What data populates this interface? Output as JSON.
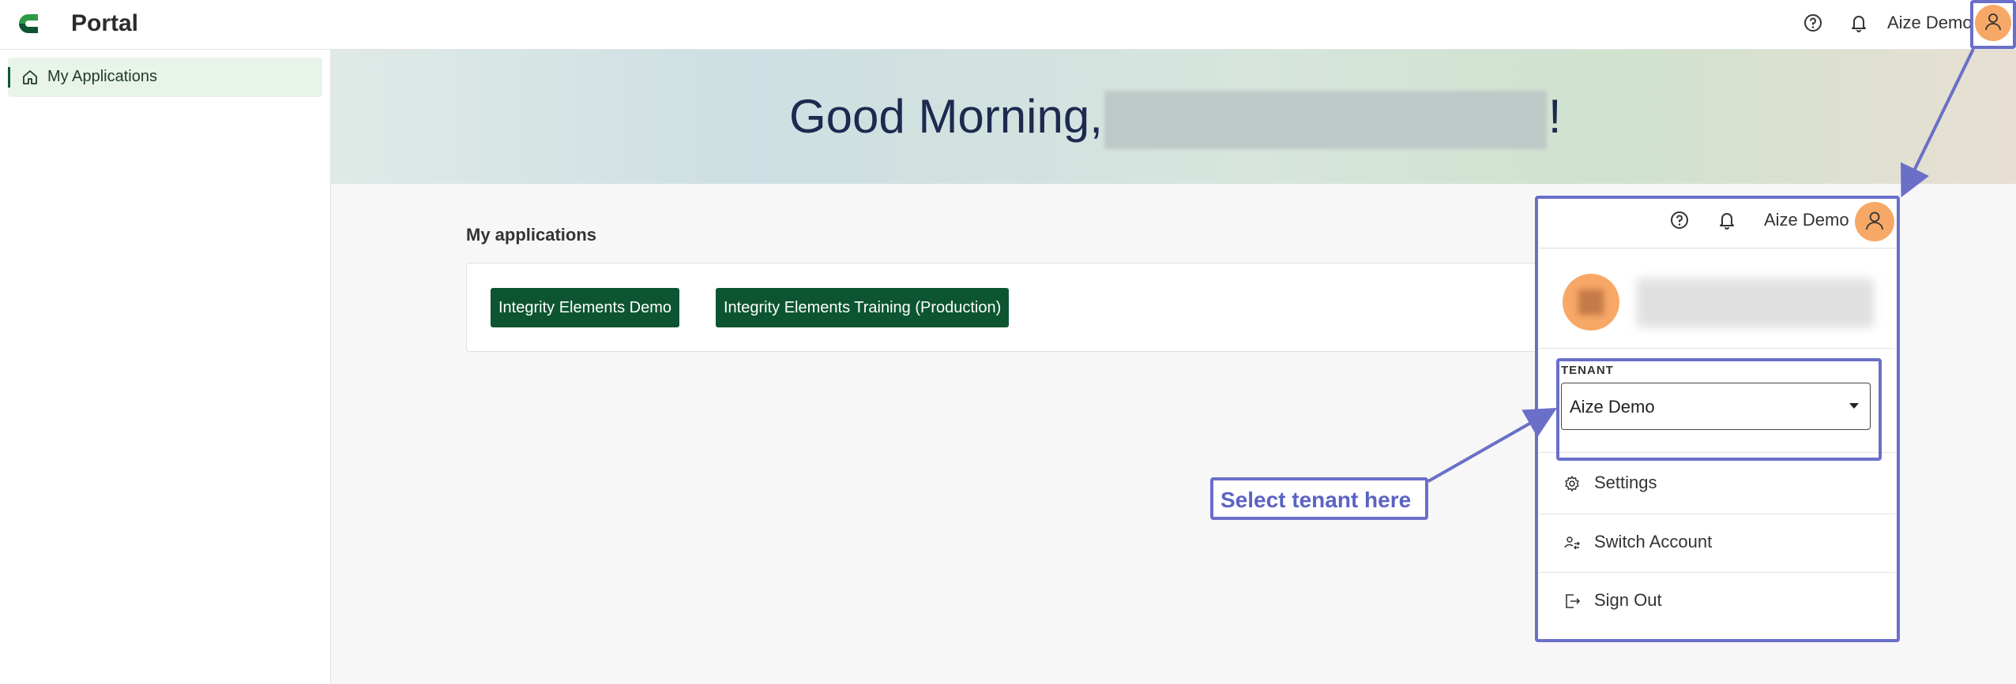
{
  "header": {
    "app_title": "Portal",
    "help_icon": "help-circle-icon",
    "notifications_icon": "bell-icon",
    "tenant_name": "Aize Demo",
    "avatar_icon": "user-icon"
  },
  "sidebar": {
    "items": [
      {
        "label": "My Applications",
        "icon": "home-icon",
        "active": true
      }
    ]
  },
  "hero": {
    "greeting_prefix": "Good Morning,",
    "greeting_suffix": "!"
  },
  "applications": {
    "title": "My applications",
    "items": [
      {
        "label": "Integrity Elements Demo"
      },
      {
        "label": "Integrity Elements Training (Production)"
      }
    ]
  },
  "user_menu": {
    "header_tenant_name": "Aize Demo",
    "tenant_label": "TENANT",
    "tenant_selected": "Aize Demo",
    "items": [
      {
        "label": "Settings",
        "icon": "gear-icon"
      },
      {
        "label": "Switch Account",
        "icon": "switch-account-icon"
      },
      {
        "label": "Sign Out",
        "icon": "sign-out-icon"
      }
    ]
  },
  "annotation": {
    "callout_text": "Select tenant here"
  },
  "colors": {
    "primary_green": "#0d5532",
    "annotation": "#6a6fc8",
    "avatar": "#f7a867"
  }
}
